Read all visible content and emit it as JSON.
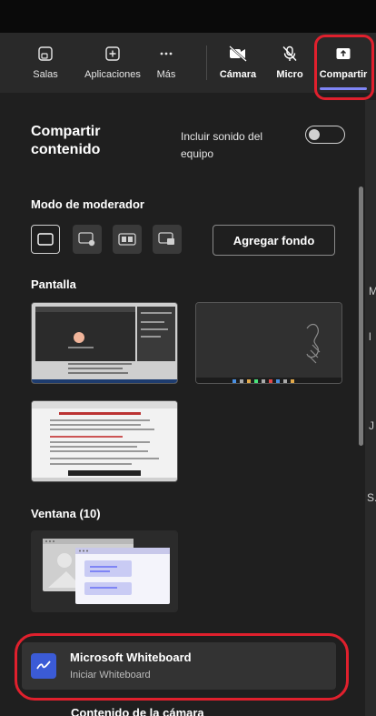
{
  "toolbar": {
    "items": [
      {
        "label": "Salas",
        "icon": "rooms-icon"
      },
      {
        "label": "Aplicaciones",
        "icon": "apps-icon"
      },
      {
        "label": "Más",
        "icon": "more-icon"
      },
      {
        "label": "Cámara",
        "icon": "camera-off-icon"
      },
      {
        "label": "Micro",
        "icon": "mic-off-icon"
      },
      {
        "label": "Compartir",
        "icon": "share-icon"
      }
    ],
    "active": "Compartir",
    "accent": "#7f85f5",
    "highlight": "#e0202d"
  },
  "share_panel": {
    "title": "Compartir contenido",
    "include_sound_label": "Incluir sonido del equipo",
    "include_sound_on": false,
    "presenter_mode_label": "Modo de moderador",
    "presenter_modes": [
      "content-only",
      "standout",
      "side-by-side",
      "reporter"
    ],
    "add_background_label": "Agregar fondo",
    "screen_label": "Pantalla",
    "window_label": "Ventana (10)",
    "whiteboard": {
      "name": "Microsoft Whiteboard",
      "subtitle": "Iniciar Whiteboard"
    },
    "camera_content_label": "Contenido de la cámara"
  },
  "right_edge_text": [
    "M",
    "l",
    "J",
    "S."
  ]
}
